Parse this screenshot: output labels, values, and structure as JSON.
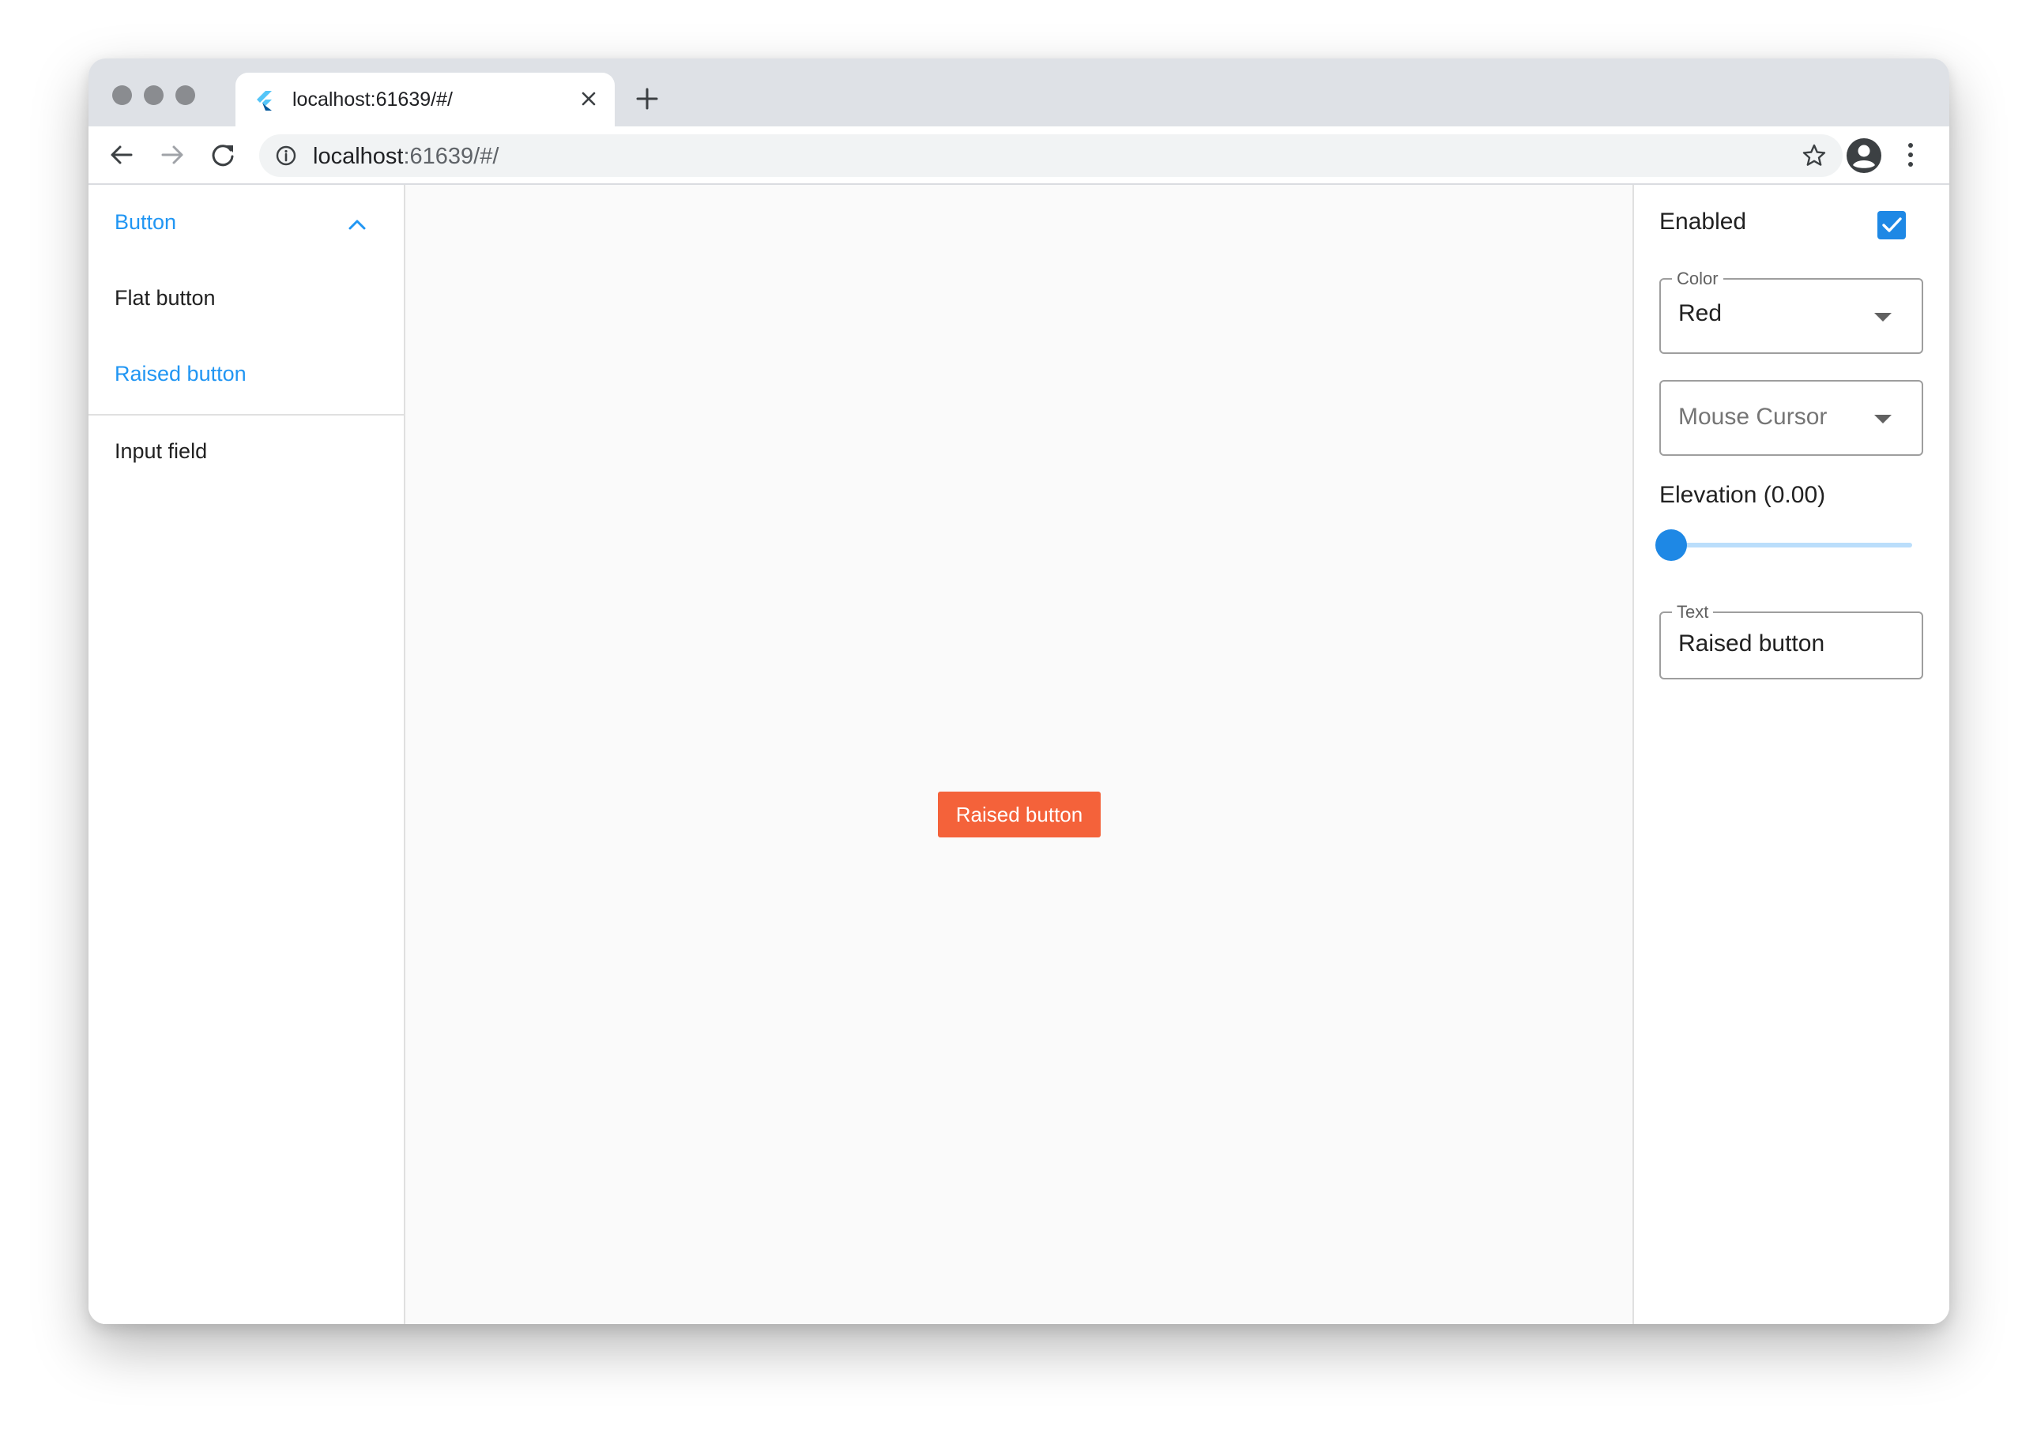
{
  "browser": {
    "tab_title": "localhost:61639/#/",
    "url_host": "localhost",
    "url_rest": ":61639/#/",
    "traffic_light_color": "#8a8c90"
  },
  "sidebar": {
    "section": {
      "label": "Button",
      "expanded": true
    },
    "items": [
      {
        "label": "Flat button",
        "active": false
      },
      {
        "label": "Raised button",
        "active": true
      },
      {
        "label": "Input field",
        "active": false
      }
    ],
    "accent_color": "#2196f3"
  },
  "preview": {
    "button_label": "Raised button",
    "button_color": "#f4623a"
  },
  "properties": {
    "enabled": {
      "label": "Enabled",
      "checked": true
    },
    "color": {
      "legend": "Color",
      "value": "Red"
    },
    "mouse_cursor": {
      "placeholder": "Mouse Cursor"
    },
    "elevation": {
      "label": "Elevation (0.00)",
      "value": 0.0
    },
    "text": {
      "legend": "Text",
      "value": "Raised button"
    }
  },
  "icons": {
    "tab_favicon": "flutter-icon",
    "tab_close": "close-icon",
    "new_tab": "plus-icon",
    "back": "arrow-left-icon",
    "forward": "arrow-right-icon",
    "reload": "reload-icon",
    "info": "info-icon",
    "bookmark": "star-icon",
    "profile": "account-circle-icon",
    "menu": "more-vert-icon",
    "chevron": "chevron-up-icon",
    "dropdown": "caret-down-icon",
    "check": "check-icon"
  }
}
